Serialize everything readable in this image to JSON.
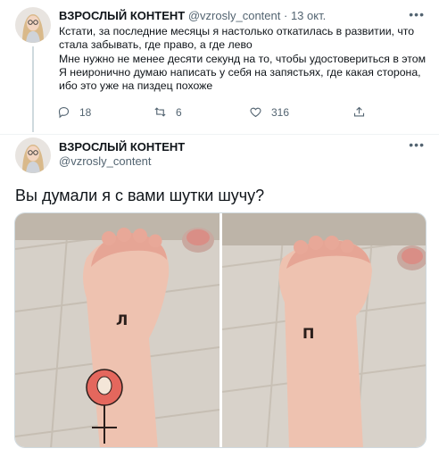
{
  "tweet1": {
    "author_name": "ВЗРОСЛЫЙ КОНТЕНТ",
    "handle": "@vzrosly_content",
    "separator": " · ",
    "date": "13 окт.",
    "lines": [
      "Кстати, за последние месяцы я настолько откатилась в развитии, что",
      "стала забывать, где право, а где лево",
      "Мне нужно не менее десяти секунд на то, чтобы удостовериться в этом",
      "Я неиронично думаю написать у себя на запястьях, где какая сторона,",
      "ибо это уже на пиздец похоже"
    ],
    "reply_count": "18",
    "retweet_count": "6",
    "like_count": "316",
    "more_icon": "more-dots-icon"
  },
  "tweet2": {
    "author_name": "ВЗРОСЛЫЙ КОНТЕНТ",
    "handle": "@vzrosly_content",
    "text": "Вы думали я с вами шутки шучу?",
    "left_wrist_letter": "Л",
    "right_wrist_letter": "П",
    "more_icon": "more-dots-icon"
  },
  "colors": {
    "text": "#0f1419",
    "secondary": "#536471",
    "divider": "#eff3f4"
  }
}
